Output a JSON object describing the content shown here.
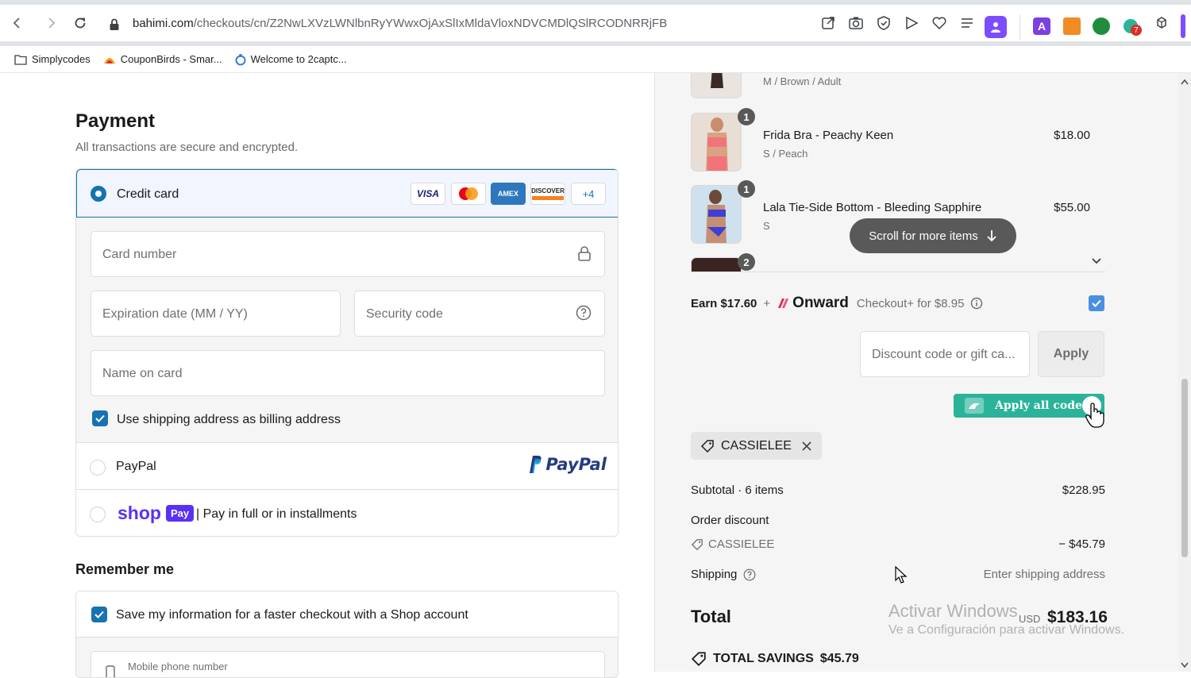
{
  "browser": {
    "url_domain": "bahimi.com",
    "url_path": "/checkouts/cn/Z2NwLXVzLWNlbnRyYWwxOjAxSlIxMldaVloxNDVCMDlQSlRCODNRRjFB",
    "bookmarks": [
      "Simplycodes",
      "CouponBirds - Smar...",
      "Welcome to 2captc..."
    ],
    "ext_badge": "7"
  },
  "payment": {
    "title": "Payment",
    "subtitle": "All transactions are secure and encrypted.",
    "credit_card_label": "Credit card",
    "card_brands": [
      "VISA",
      "Mastercard",
      "AMEX",
      "DISCOVER"
    ],
    "more_brands": "+4",
    "card_number_placeholder": "Card number",
    "expiration_placeholder": "Expiration date (MM / YY)",
    "security_placeholder": "Security code",
    "name_placeholder": "Name on card",
    "billing_same_label": "Use shipping address as billing address",
    "paypal_label": "PayPal",
    "paypal_logo": "PayPal",
    "shop_logo": "shop",
    "shop_pay_badge": "Pay",
    "shop_label": "| Pay in full or in installments"
  },
  "remember": {
    "title": "Remember me",
    "save_label": "Save my information for a faster checkout with a Shop account",
    "phone_placeholder": "Mobile phone number"
  },
  "order": {
    "items": [
      {
        "name": "",
        "variant": "M / Brown / Adult",
        "price": "",
        "qty": ""
      },
      {
        "name": "Frida Bra - Peachy Keen",
        "variant": "S / Peach",
        "price": "$18.00",
        "qty": "1"
      },
      {
        "name": "Lala Tie-Side Bottom - Bleeding Sapphire",
        "variant": "S",
        "price": "$55.00",
        "qty": "1"
      },
      {
        "name": "",
        "variant": "",
        "price": "",
        "qty": "2"
      }
    ],
    "scroll_hint": "Scroll for more items",
    "onward": {
      "earn": "Earn $17.60",
      "plus": "+",
      "brand": "Onward",
      "checkout_plus": "Checkout+ for $8.95",
      "checked": true
    },
    "discount_placeholder": "Discount code or gift ca...",
    "apply_label": "Apply",
    "apply_all_label": "Apply all codes",
    "applied_code": "CASSIELEE",
    "subtotal_label": "Subtotal · 6 items",
    "subtotal_value": "$228.95",
    "order_discount_label": "Order discount",
    "discount_code": "CASSIELEE",
    "discount_value": "− $45.79",
    "shipping_label": "Shipping",
    "shipping_value": "Enter shipping address",
    "total_label": "Total",
    "total_currency": "USD",
    "total_value": "$183.16",
    "savings_label": "TOTAL SAVINGS",
    "savings_value": "$45.79"
  },
  "watermark": {
    "line1": "Activar Windows",
    "line2": "Ve a Configuración para activar Windows."
  },
  "colors": {
    "accent": "#1773b0",
    "apply_all": "#2bb39a",
    "shop_purple": "#5a31f4",
    "paypal_blue": "#253b80",
    "paypal_light": "#179bd7"
  }
}
